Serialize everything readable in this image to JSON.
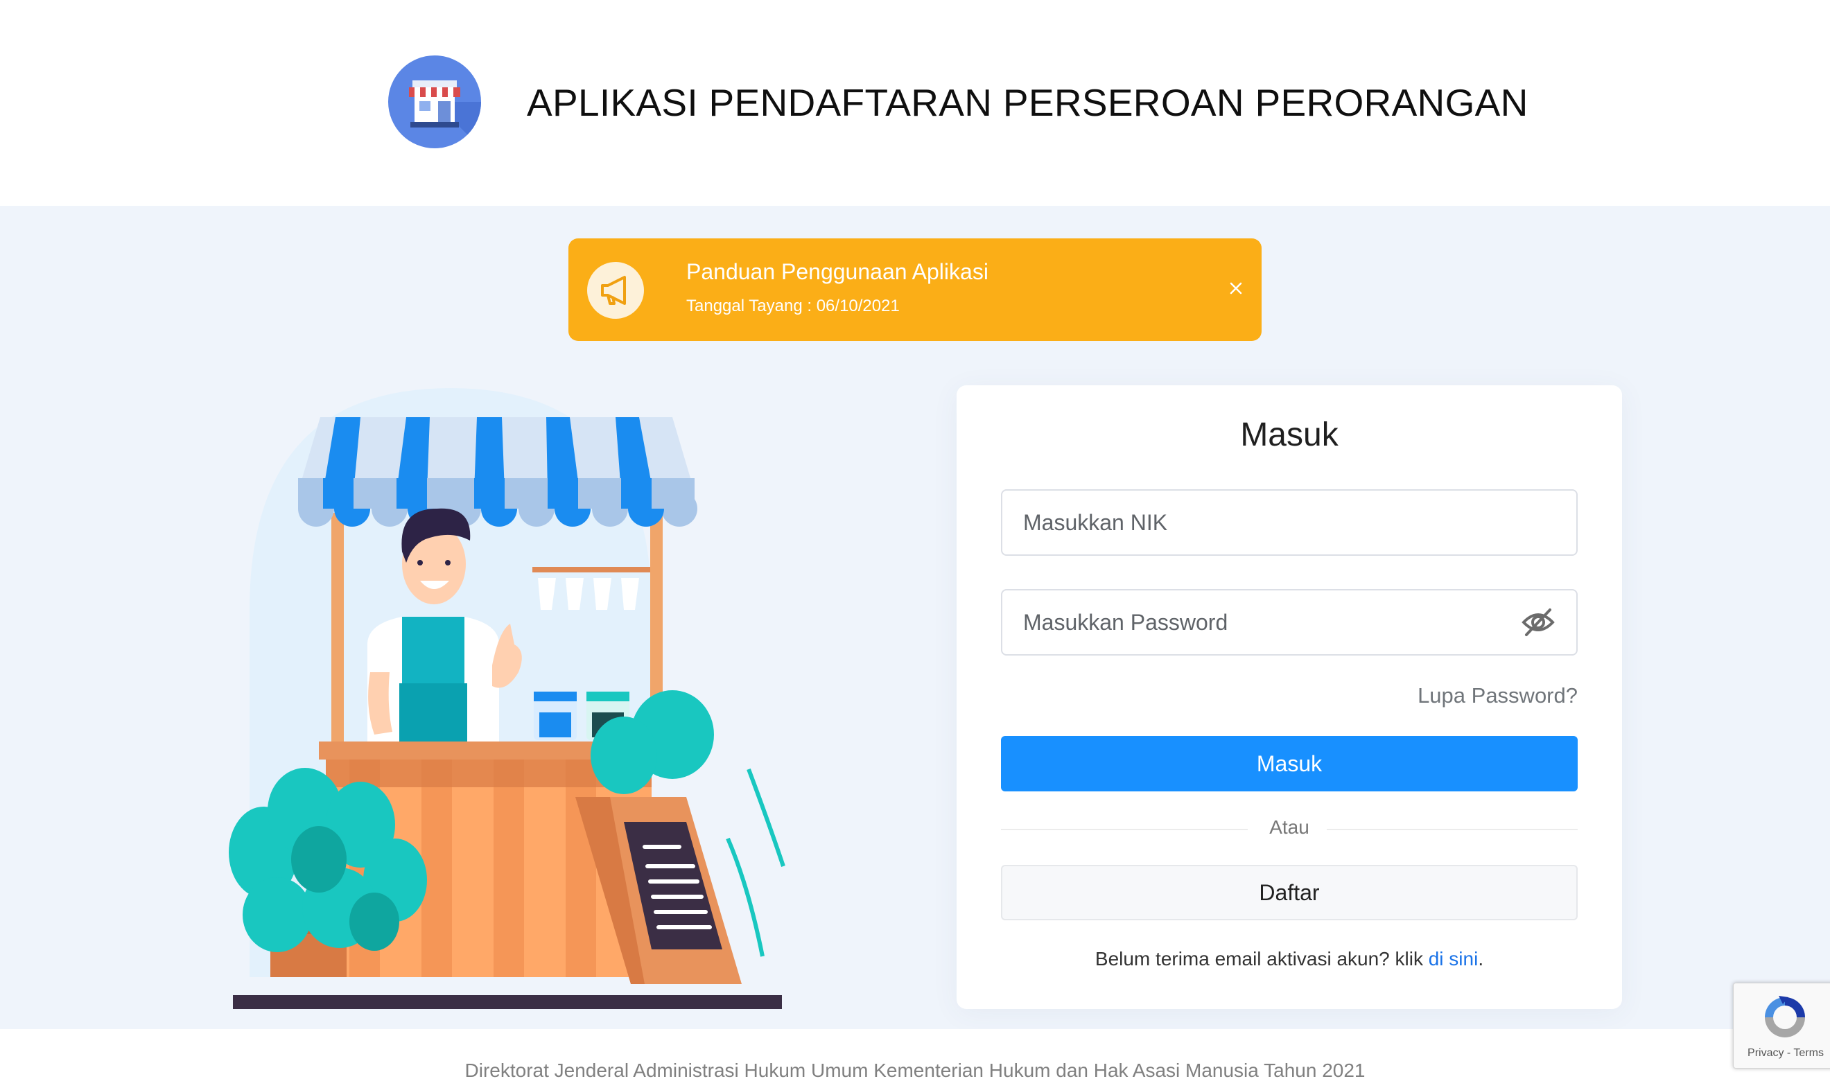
{
  "header": {
    "logo_icon": "storefront-icon",
    "title": "APLIKASI PENDAFTARAN PERSEROAN PERORANGAN"
  },
  "notice": {
    "icon": "megaphone-icon",
    "title": "Panduan Penggunaan Aplikasi",
    "date": "Tanggal Tayang : 06/10/2021",
    "close_icon": "close-icon",
    "color": "#fbae17"
  },
  "illustration": {
    "description_icon": "shop-vendor-illustration"
  },
  "login": {
    "title": "Masuk",
    "nik_placeholder": "Masukkan NIK",
    "nik_value": "",
    "password_placeholder": "Masukkan Password",
    "password_value": "",
    "eye_icon": "eye-slash-icon",
    "forgot_label": "Lupa Password?",
    "submit_label": "Masuk",
    "divider_label": "Atau",
    "register_label": "Daftar",
    "activation_text": "Belum terima email aktivasi akun? klik ",
    "activation_link": "di sini",
    "activation_suffix": ".",
    "primary_color": "#1890ff"
  },
  "footer": {
    "text": "Direktorat Jenderal Administrasi Hukum Umum Kementerian Hukum dan Hak Asasi Manusia Tahun 2021"
  },
  "recaptcha": {
    "icon": "recaptcha-icon",
    "links": "Privacy - Terms"
  }
}
